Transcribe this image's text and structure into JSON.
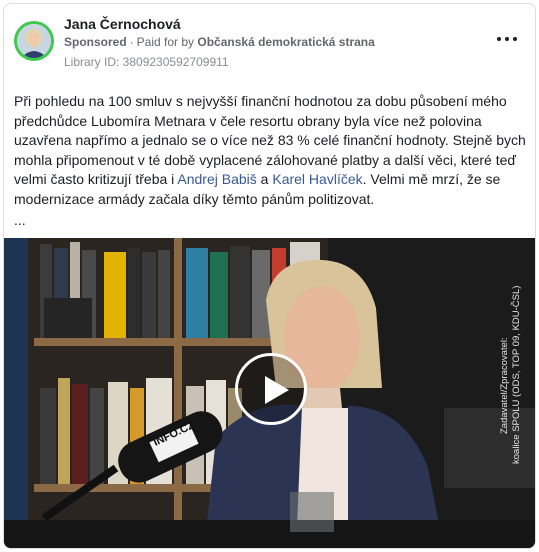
{
  "post": {
    "author": "Jana Černochová",
    "sponsored": "Sponsored",
    "paid_for_prefix": "Paid for by",
    "payer": "Občanská demokratická strana",
    "library_id": "Library ID: 3809230592709911",
    "text_part1": "Při pohledu na 100 smluv s nejvyšší finanční hodnotou za dobu působení mého předchůdce Lubomíra Metnara v čele resortu obrany byla více než polovina uzavřena napřímo a jednalo se o více než 83 % celé finanční hodnoty. Stejně bych mohla připomenout v té době vyplacené zálohované platby a další věci, které teď velmi často kritizují třeba i ",
    "link1": "Andrej Babiš",
    "text_part2": " a ",
    "link2": "Karel Havlíček",
    "text_part3": ". Velmi mě mrzí, že se modernizace armády začala díky těmto pánům politizovat.",
    "ellipsis": "..."
  },
  "video": {
    "disclaimer_line1": "Zadavatel/Zpracovatel:",
    "disclaimer_line2": "koalice SPOLU (ODS, TOP 09, KDU-ČSL)",
    "mic_brand": "INFO.CZ"
  },
  "icons": {
    "more": "more-options-icon",
    "play": "play-icon",
    "avatar": "profile-photo"
  },
  "colors": {
    "avatar_ring": "#3cc94e",
    "link": "#385898",
    "muted": "#65676b"
  }
}
